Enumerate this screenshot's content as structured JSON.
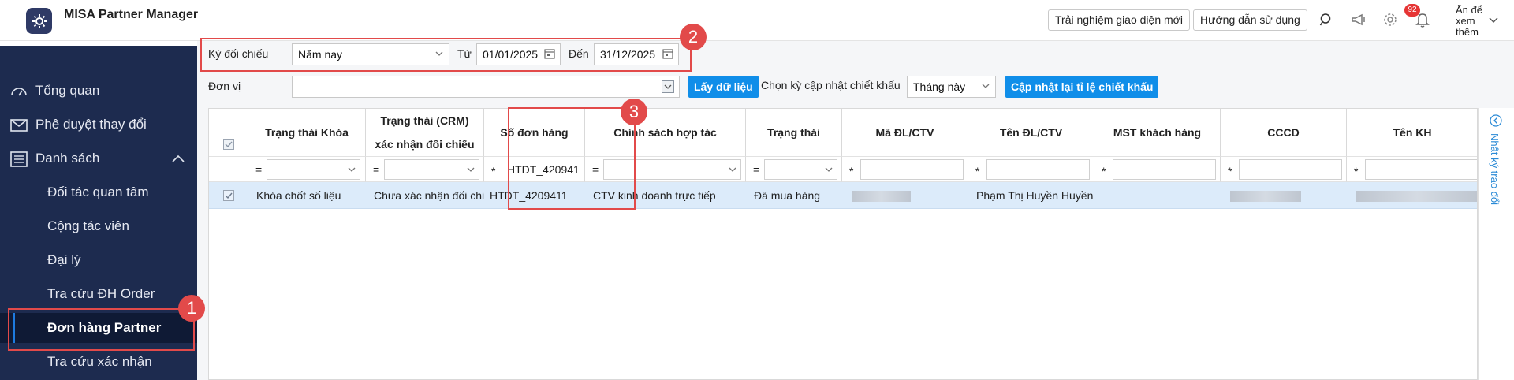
{
  "app": {
    "title": "MISA Partner Manager"
  },
  "topbar": {
    "btn_new_ui": "Trải nghiệm giao diện mới",
    "btn_guide": "Hướng dẫn sử dụng",
    "notification_count": "92",
    "hide_label": "Ẩn để xem thêm"
  },
  "sidebar": {
    "items": [
      {
        "label": "Tổng quan",
        "icon": "dashboard-icon"
      },
      {
        "label": "Phê duyệt thay đổi",
        "icon": "mail-icon"
      },
      {
        "label": "Danh sách",
        "icon": "list-icon"
      },
      {
        "label": "Đối tác quan tâm"
      },
      {
        "label": "Cộng tác viên"
      },
      {
        "label": "Đại lý"
      },
      {
        "label": "Tra cứu ĐH Order"
      },
      {
        "label": "Đơn hàng Partner"
      },
      {
        "label": "Tra cứu xác nhận"
      }
    ],
    "active": "Đơn hàng Partner"
  },
  "filters": {
    "period_label": "Kỳ đối chiếu",
    "period_value": "Năm nay",
    "from_label": "Từ",
    "from_value": "01/01/2025",
    "to_label": "Đến",
    "to_value": "31/12/2025",
    "unit_label": "Đơn vị",
    "unit_value": "",
    "load_button": "Lấy dữ liệu",
    "discount_period_label": "Chọn kỳ cập nhật chiết khấu",
    "discount_period_value": "Tháng này",
    "update_button": "Cập nhật lại tỉ lệ chiết khấu"
  },
  "grid": {
    "columns": [
      {
        "h1": "Trạng thái Khóa",
        "op": "="
      },
      {
        "h1": "Trạng thái (CRM)",
        "h2": "xác nhận đối chiếu",
        "op": "="
      },
      {
        "h1": "Số đơn hàng",
        "op": "*",
        "filter": "HTDT_420941"
      },
      {
        "h1": "Chính sách hợp tác",
        "op": "="
      },
      {
        "h1": "Trạng thái",
        "op": "="
      },
      {
        "h1": "Mã ĐL/CTV",
        "op": "*"
      },
      {
        "h1": "Tên ĐL/CTV",
        "op": "*"
      },
      {
        "h1": "MST khách hàng",
        "op": "*"
      },
      {
        "h1": "CCCD",
        "op": "*"
      },
      {
        "h1": "Tên KH",
        "op": "*"
      }
    ],
    "rows": [
      {
        "lock_status": "Khóa chốt số liệu",
        "crm_status": "Chưa xác nhận đối chiếu",
        "order_no": "HTDT_4209411",
        "policy": "CTV kinh doanh trực tiếp",
        "status": "Đã mua hàng",
        "agent_code": "",
        "agent_name": "Phạm Thị Huyền Huyền",
        "tax_code": "",
        "id_card": "",
        "customer_name": ""
      }
    ]
  },
  "side_panel": {
    "label": "Nhật ký trao đổi"
  },
  "annotations": [
    "1",
    "2",
    "3"
  ],
  "colors": {
    "sidebar": "#1d2b4f",
    "accent": "#108ee9",
    "annotation": "#e24a4a",
    "selected_row": "#dcebfa"
  }
}
